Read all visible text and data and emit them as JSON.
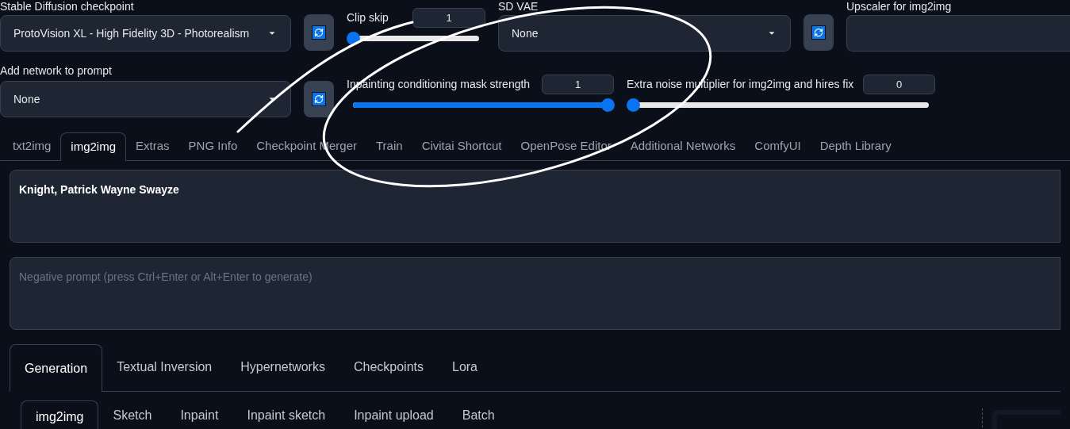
{
  "checkpoint": {
    "label": "Stable Diffusion checkpoint",
    "value": "ProtoVision XL - High Fidelity 3D - Photorealism"
  },
  "clip_skip": {
    "label": "Clip skip",
    "value": "1",
    "level": 0
  },
  "sd_vae": {
    "label": "SD VAE",
    "value": "None"
  },
  "upscaler": {
    "label": "Upscaler for img2img"
  },
  "network": {
    "label": "Add network to prompt",
    "value": "None"
  },
  "mask_strength": {
    "label": "Inpainting conditioning mask strength",
    "value": "1",
    "level": 1
  },
  "extra_noise": {
    "label": "Extra noise multiplier for img2img and hires fix",
    "value": "0",
    "level": 0
  },
  "tabs": [
    {
      "label": "txt2img",
      "selected": false
    },
    {
      "label": "img2img",
      "selected": true
    },
    {
      "label": "Extras",
      "selected": false
    },
    {
      "label": "PNG Info",
      "selected": false
    },
    {
      "label": "Checkpoint Merger",
      "selected": false
    },
    {
      "label": "Train",
      "selected": false
    },
    {
      "label": "Civitai Shortcut",
      "selected": false
    },
    {
      "label": "OpenPose Editor",
      "selected": false
    },
    {
      "label": "Additional Networks",
      "selected": false
    },
    {
      "label": "ComfyUI",
      "selected": false
    },
    {
      "label": "Depth Library",
      "selected": false
    }
  ],
  "prompt": {
    "value": "Knight, Patrick Wayne Swayze"
  },
  "negative_prompt": {
    "placeholder": "Negative prompt (press Ctrl+Enter or Alt+Enter to generate)"
  },
  "card_tabs": [
    {
      "label": "Generation",
      "selected": true
    },
    {
      "label": "Textual Inversion",
      "selected": false
    },
    {
      "label": "Hypernetworks",
      "selected": false
    },
    {
      "label": "Checkpoints",
      "selected": false
    },
    {
      "label": "Lora",
      "selected": false
    }
  ],
  "sub_tabs": [
    {
      "label": "img2img",
      "selected": true
    },
    {
      "label": "Sketch",
      "selected": false
    },
    {
      "label": "Inpaint",
      "selected": false
    },
    {
      "label": "Inpaint sketch",
      "selected": false
    },
    {
      "label": "Inpaint upload",
      "selected": false
    },
    {
      "label": "Batch",
      "selected": false
    }
  ]
}
